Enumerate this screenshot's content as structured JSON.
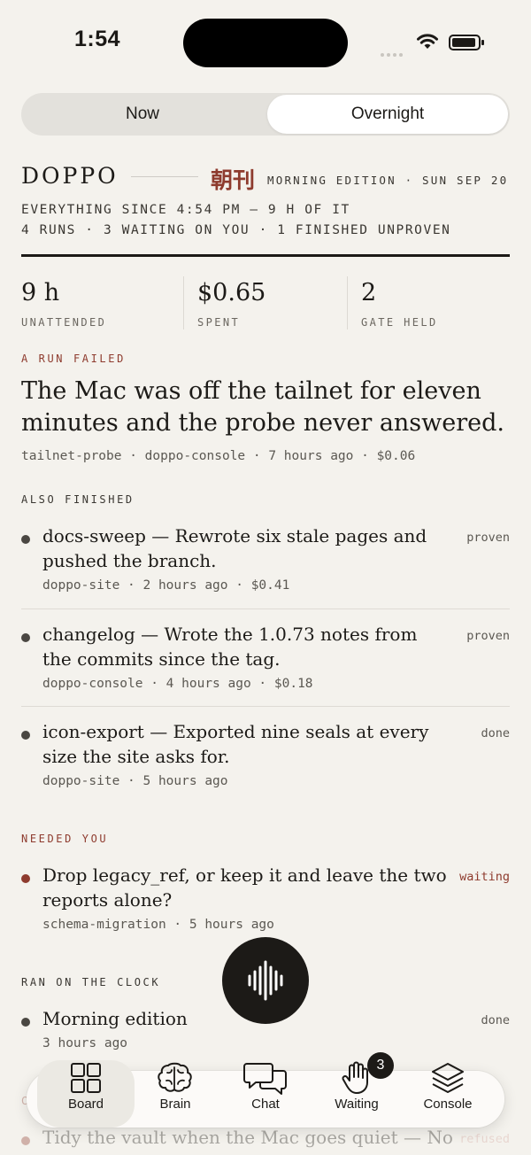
{
  "status_bar": {
    "time": "1:54"
  },
  "segments": {
    "now": "Now",
    "overnight": "Overnight",
    "selected": "Overnight"
  },
  "masthead": {
    "title": "DOPPO",
    "kanji": "朝刊",
    "edition": "MORNING EDITION · SUN SEP 20",
    "line1": "EVERYTHING SINCE 4:54 PM — 9 H OF IT",
    "line2": "4 RUNS · 3 WAITING ON YOU · 1 FINISHED UNPROVEN"
  },
  "stats": [
    {
      "value": "9 h",
      "label": "UNATTENDED"
    },
    {
      "value": "$0.65",
      "label": "SPENT"
    },
    {
      "value": "2",
      "label": "GATE HELD"
    }
  ],
  "failed": {
    "label": "A RUN FAILED",
    "headline": "The Mac was off the tailnet for eleven minutes and the probe never answered.",
    "meta": "tailnet-probe · doppo-console · 7 hours ago · $0.06"
  },
  "also_finished": {
    "label": "ALSO FINISHED",
    "items": [
      {
        "title": "docs-sweep — Rewrote six stale pages and pushed the branch.",
        "meta": "doppo-site · 2 hours ago · $0.41",
        "status": "proven"
      },
      {
        "title": "changelog — Wrote the 1.0.73 notes from the commits since the tag.",
        "meta": "doppo-console · 4 hours ago · $0.18",
        "status": "proven"
      },
      {
        "title": "icon-export — Exported nine seals at every size the site asks for.",
        "meta": "doppo-site · 5 hours ago",
        "status": "done"
      }
    ]
  },
  "needed_you": {
    "label": "NEEDED YOU",
    "items": [
      {
        "title": "Drop legacy_ref, or keep it and leave the two reports alone?",
        "meta": "schema-migration · 5 hours ago",
        "status": "waiting"
      }
    ]
  },
  "on_the_clock": {
    "label": "RAN ON THE CLOCK",
    "items": [
      {
        "title": "Morning edition",
        "meta": "3 hours ago",
        "status": "done"
      }
    ]
  },
  "below": {
    "label_partial": "C",
    "item_title": "Tidy the vault when the Mac goes quiet — No",
    "item_status": "refused"
  },
  "tabbar": {
    "tabs": [
      {
        "label": "Board",
        "icon": "board-grid-icon"
      },
      {
        "label": "Brain",
        "icon": "brain-icon"
      },
      {
        "label": "Chat",
        "icon": "chat-bubbles-icon"
      },
      {
        "label": "Waiting",
        "icon": "hand-icon",
        "badge": "3"
      },
      {
        "label": "Console",
        "icon": "layers-icon"
      }
    ],
    "selected": "Board"
  },
  "colors": {
    "accent": "#8e3b2e",
    "background": "#f4f2ed",
    "ink": "#1c1a17"
  }
}
